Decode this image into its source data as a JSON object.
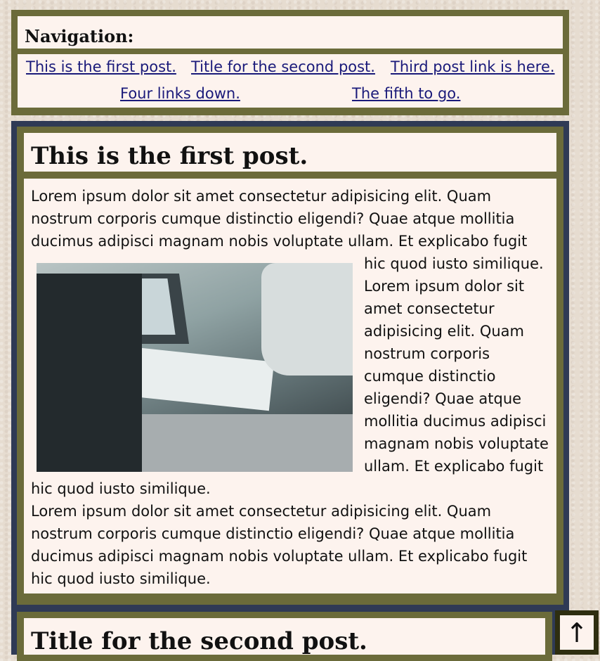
{
  "navigation": {
    "heading": "Navigation:",
    "links": [
      "This is the first post.",
      "Title for the second post.",
      "Third post link is here.",
      "Four links down.",
      "The fifth to go."
    ]
  },
  "post1": {
    "title": "This is the first post.",
    "para1_before_image": "Lorem ipsum dolor sit amet consectetur adipisicing elit. Quam nostrum corporis cumque distinctio eligendi? Quae atque mollitia ducimus adipisci magnam nobis voluptate ullam. Et explicabo fugit",
    "para1_after_image": "hic quod iusto similique. Lorem ipsum dolor sit amet consectetur adipisicing elit. Quam nostrum corporis cumque distinctio eligendi? Quae atque mollitia ducimus adipisci magnam nobis voluptate ullam. Et explicabo fugit hic quod iusto similique.",
    "para2": "Lorem ipsum dolor sit amet consectetur adipisicing elit. Quam nostrum corporis cumque distinctio eligendi? Quae atque mollitia ducimus adipisci magnam nobis voluptate ullam. Et explicabo fugit hic quod iusto similique."
  },
  "post2": {
    "title": "Title for the second post."
  },
  "back_to_top": {
    "glyph": "↑"
  }
}
